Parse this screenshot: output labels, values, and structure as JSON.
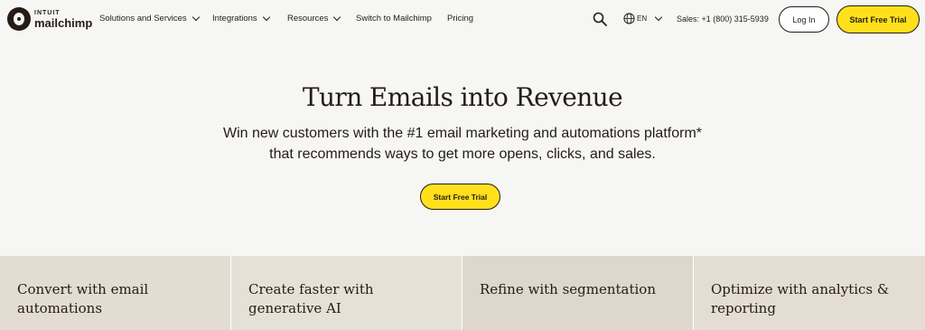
{
  "brand": {
    "top": "INTUIT",
    "name": "mailchimp"
  },
  "nav": {
    "items": [
      {
        "label": "Solutions and Services",
        "dropdown": true
      },
      {
        "label": "Integrations",
        "dropdown": true
      },
      {
        "label": "Resources",
        "dropdown": true
      },
      {
        "label": "Switch to Mailchimp",
        "dropdown": false
      },
      {
        "label": "Pricing",
        "dropdown": false
      }
    ],
    "language": "EN",
    "sales": "Sales: +1 (800) 315-5939",
    "login_label": "Log In",
    "trial_label": "Start Free Trial"
  },
  "hero": {
    "title": "Turn Emails into Revenue",
    "subtitle_line1": "Win new customers with the #1 email marketing and automations platform*",
    "subtitle_line2": "that recommends ways to get more opens, clicks, and sales.",
    "cta_label": "Start Free Trial"
  },
  "features": [
    {
      "title": "Convert with email automations"
    },
    {
      "title": "Create faster with generative AI"
    },
    {
      "title": "Refine with segmentation"
    },
    {
      "title": "Optimize with analytics & reporting"
    }
  ],
  "colors": {
    "accent": "#ffe01b",
    "text": "#241c15",
    "background": "#f6f6f4"
  }
}
